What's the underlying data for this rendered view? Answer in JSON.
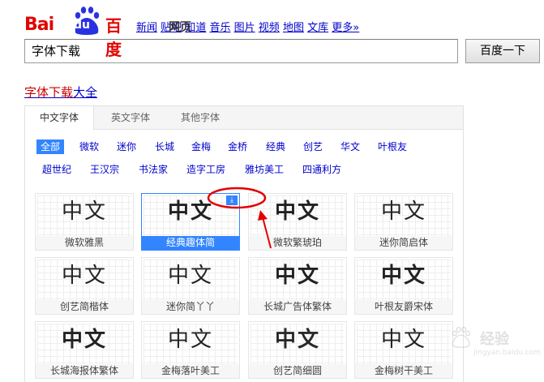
{
  "logo": {
    "latin_a": "Bai",
    "latin_b": "du",
    "chinese": "百度"
  },
  "topnav": [
    "新闻",
    "网页",
    "贴吧",
    "知道",
    "音乐",
    "图片",
    "视频",
    "地图",
    "文库",
    "更多»"
  ],
  "search": {
    "value": "字体下载",
    "button": "百度一下"
  },
  "result": {
    "title_highlight": "字体下载",
    "title_rest": "大全"
  },
  "tabs": [
    "中文字体",
    "英文字体",
    "其他字体"
  ],
  "filters": {
    "row1": [
      "全部",
      "微软",
      "迷你",
      "长城",
      "金梅",
      "金桥",
      "经典",
      "创艺",
      "华文",
      "叶根友"
    ],
    "row2": [
      "超世纪",
      "王汉宗",
      "书法家",
      "造字工房",
      "雅坊美工",
      "四通利方"
    ]
  },
  "fonts": [
    {
      "glyph": "中文",
      "name": "微软雅黑"
    },
    {
      "glyph": "中文",
      "name": "经典趣体简"
    },
    {
      "glyph": "中文",
      "name": "微软繁琥珀"
    },
    {
      "glyph": "中文",
      "name": "迷你简启体"
    },
    {
      "glyph": "中文",
      "name": "创艺简楷体"
    },
    {
      "glyph": "中文",
      "name": "迷你简丫丫"
    },
    {
      "glyph": "中文",
      "name": "长城广告体繁体"
    },
    {
      "glyph": "中文",
      "name": "叶根友爵宋体"
    },
    {
      "glyph": "中文",
      "name": "长城海报体繁体"
    },
    {
      "glyph": "中文",
      "name": "金梅落叶美工"
    },
    {
      "glyph": "中文",
      "name": "创艺简细圆"
    },
    {
      "glyph": "中文",
      "name": "金梅树干美工"
    }
  ],
  "watermark": {
    "text": "经验",
    "url": "jingyan.baidu.com"
  },
  "colors": {
    "brand_red": "#e10602",
    "accent_blue": "#3385ff",
    "annotation_red": "#e00000"
  }
}
